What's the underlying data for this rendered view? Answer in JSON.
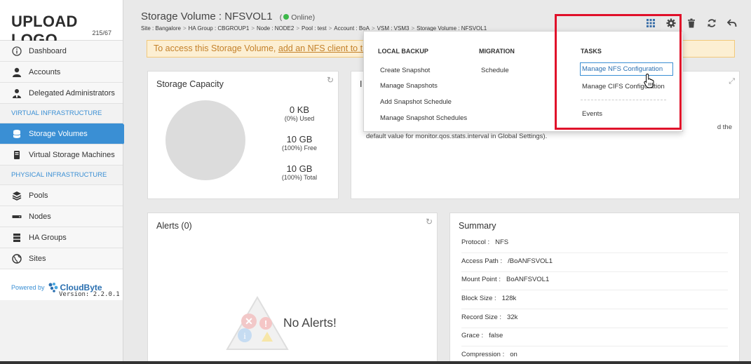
{
  "logo": {
    "main": "UPLOAD LOGO",
    "sub": "215/67"
  },
  "sidebar": {
    "items": [
      {
        "label": "Dashboard",
        "icon": "info-icon"
      },
      {
        "label": "Accounts",
        "icon": "user-icon"
      },
      {
        "label": "Delegated Administrators",
        "icon": "admin-icon"
      }
    ],
    "section_virtual": "VIRTUAL INFRASTRUCTURE",
    "virtual_items": [
      {
        "label": "Storage Volumes",
        "icon": "database-icon"
      },
      {
        "label": "Virtual Storage Machines",
        "icon": "server-icon"
      }
    ],
    "section_physical": "PHYSICAL INFRASTRUCTURE",
    "physical_items": [
      {
        "label": "Pools",
        "icon": "layers-icon"
      },
      {
        "label": "Nodes",
        "icon": "node-icon"
      },
      {
        "label": "HA Groups",
        "icon": "ha-icon"
      },
      {
        "label": "Sites",
        "icon": "globe-icon"
      }
    ],
    "powered_by": "Powered by",
    "brand": "CloudByte",
    "version": "Version: 2.2.0.1"
  },
  "header": {
    "title": "Storage Volume : NFSVOL1",
    "status": "Online",
    "status_open": "(",
    "status_close": ")",
    "status_color": "#3db84a",
    "breadcrumb": [
      "Site : Bangalore",
      "HA Group : CBGROUP1",
      "Node : NODE2",
      "Pool : test",
      "Account : BoA",
      "VSM : VSM3",
      "Storage Volume : NFSVOL1"
    ],
    "sep": ">"
  },
  "toolbar": {
    "icons": [
      "apps-grid-icon",
      "gear-icon",
      "trash-icon",
      "refresh-icon",
      "back-icon"
    ]
  },
  "info_bar": {
    "text_prefix": "To access this Storage Volume, ",
    "link_text": "add an NFS client to th"
  },
  "capacity": {
    "title": "Storage Capacity",
    "used_value": "0 KB",
    "used_label": "(0%) Used",
    "free_value": "10 GB",
    "free_label": "(100%) Free",
    "total_value": "10 GB",
    "total_label": "(100%) Total",
    "used_fraction": 0.0
  },
  "iops_card": {
    "title_fragment": "I",
    "text_line1": "d the",
    "text_line2": "default value for monitor.qos.stats.interval in Global Settings)."
  },
  "alerts": {
    "title": "Alerts (0)",
    "empty_text": "No Alerts!"
  },
  "summary": {
    "title": "Summary",
    "rows": [
      {
        "k": "Protocol :",
        "v": "NFS"
      },
      {
        "k": "Access Path :",
        "v": "/BoANFSVOL1"
      },
      {
        "k": "Mount Point :",
        "v": "BoANFSVOL1"
      },
      {
        "k": "Block Size :",
        "v": "128k"
      },
      {
        "k": "Record Size :",
        "v": "32k"
      },
      {
        "k": "Grace :",
        "v": "false"
      },
      {
        "k": "Compression :",
        "v": "on"
      }
    ]
  },
  "dropdown": {
    "local_backup": {
      "heading": "LOCAL BACKUP",
      "items": [
        "Create Snapshot",
        "Manage Snapshots",
        "Add Snapshot Schedule",
        "Manage Snapshot Schedules"
      ]
    },
    "migration": {
      "heading": "MIGRATION",
      "items": [
        "Schedule"
      ]
    },
    "tasks": {
      "heading": "TASKS",
      "items": [
        "Manage NFS Configuration",
        "Manage CIFS Configuration"
      ],
      "extra": "Events"
    }
  },
  "accent_color": "#3a8fd4",
  "highlight_color": "#e0102a"
}
